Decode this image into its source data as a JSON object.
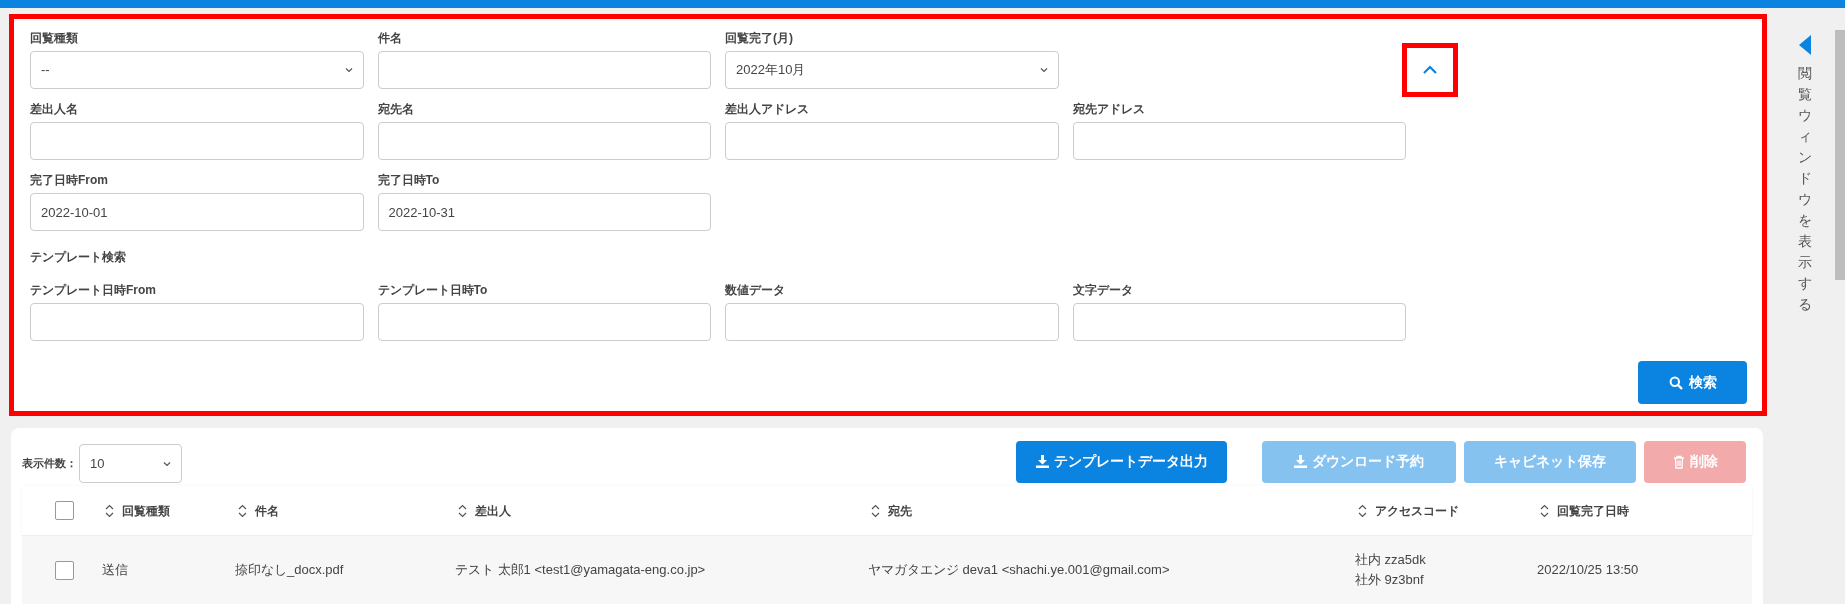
{
  "filters": {
    "rows": [
      {
        "fields": [
          {
            "kind": "select",
            "label": "回覧種類",
            "value": "--"
          },
          {
            "kind": "text",
            "label": "件名"
          },
          {
            "kind": "select",
            "label": "回覧完了(月)",
            "value": "2022年10月"
          }
        ]
      },
      {
        "fields": [
          {
            "kind": "text",
            "label": "差出人名"
          },
          {
            "kind": "text",
            "label": "宛先名"
          },
          {
            "kind": "text",
            "label": "差出人アドレス"
          },
          {
            "kind": "text",
            "label": "宛先アドレス"
          }
        ]
      },
      {
        "fields": [
          {
            "kind": "text",
            "label": "完了日時From",
            "value": "2022-10-01"
          },
          {
            "kind": "text",
            "label": "完了日時To",
            "value": "2022-10-31"
          }
        ]
      },
      {
        "heading": "テンプレート検索"
      },
      {
        "fields": [
          {
            "kind": "text",
            "label": "テンプレート日時From"
          },
          {
            "kind": "text",
            "label": "テンプレート日時To"
          },
          {
            "kind": "text",
            "label": "数値データ"
          },
          {
            "kind": "text",
            "label": "文字データ"
          }
        ]
      }
    ],
    "collapse": {
      "expanded": true
    },
    "search_button": "検索"
  },
  "side_panel": {
    "label": "閲覧ウィンドウを表示する"
  },
  "results": {
    "page_size": {
      "label": "表示件数：",
      "value": "10"
    },
    "actions": [
      {
        "label": "テンプレートデータ出力",
        "kind": "download",
        "disabled": false
      },
      {
        "label": "ダウンロード予約",
        "kind": "download",
        "disabled": true
      },
      {
        "label": "キャビネット保存",
        "kind": "plain",
        "disabled": true
      },
      {
        "label": "削除",
        "kind": "delete",
        "disabled": true
      }
    ],
    "table": {
      "select_all": {
        "checked": false
      },
      "columns": [
        "回覧種類",
        "件名",
        "差出人",
        "宛先",
        "アクセスコード",
        "回覧完了日時"
      ],
      "rows": [
        {
          "checked": false,
          "cells": [
            "送信",
            "捺印なし_docx.pdf",
            "テスト 太郎1 <test1@yamagata-eng.co.jp>",
            "ヤマガタエンジ deva1 <shachi.ye.001@gmail.com>",
            [
              "社内 zza5dk",
              "社外 9z3bnf"
            ],
            "2022/10/25 13:50"
          ]
        }
      ]
    }
  }
}
